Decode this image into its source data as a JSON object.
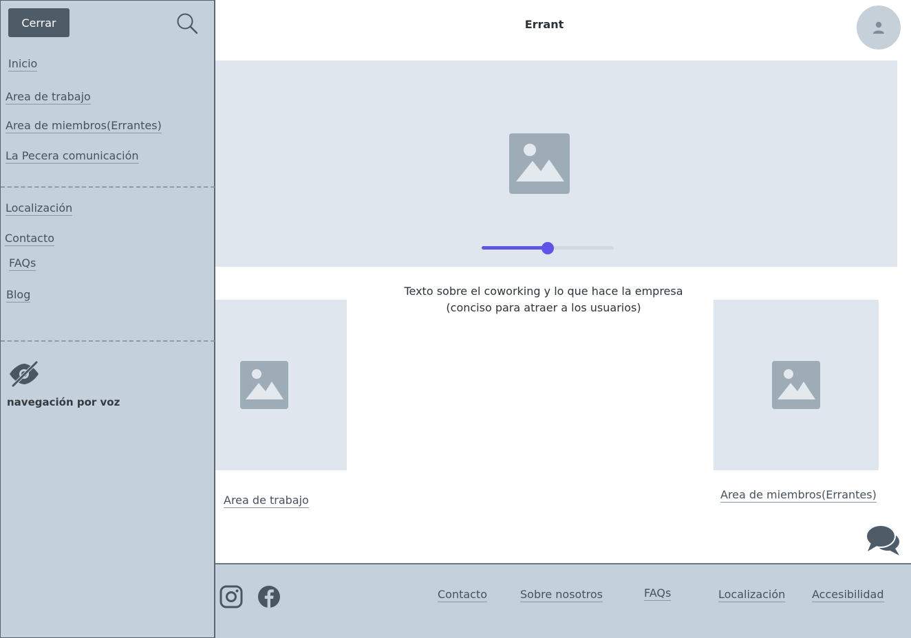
{
  "sidebar": {
    "close_label": "Cerrar",
    "nav_primary": [
      "Inicio",
      "Area de trabajo",
      "Area de miembros(Errantes)",
      "La Pecera comunicación"
    ],
    "nav_secondary": [
      "Localización",
      "Contacto",
      "FAQs",
      "Blog"
    ],
    "voice_label": "navegación por voz"
  },
  "header": {
    "title": "Errant"
  },
  "hero": {
    "slider_value_percent": 50
  },
  "intro": {
    "line1": "Texto sobre el coworking y lo que hace la empresa",
    "line2": "(conciso para atraer a los usuarios)"
  },
  "cards": [
    {
      "label": "Area de trabajo"
    },
    {
      "label": "Area de miembros(Errantes)"
    }
  ],
  "footer": {
    "links": [
      "Contacto",
      "Sobre nosotros",
      "FAQs",
      "Localización",
      "Accesibilidad"
    ]
  },
  "colors": {
    "sidebar_bg": "#c4d0db",
    "placeholder_bg": "#e0e6ed",
    "accent": "#6054e8",
    "button_bg": "#4e5c68"
  }
}
